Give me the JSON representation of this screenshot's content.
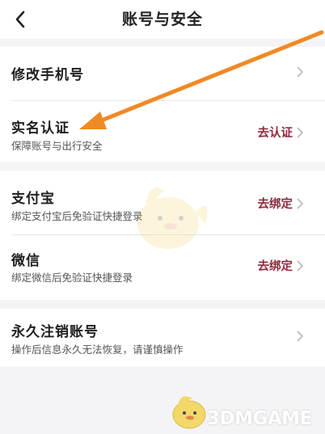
{
  "header": {
    "title": "账号与安全",
    "back_icon": "chevron-left-icon"
  },
  "rows": [
    {
      "title": "修改手机号",
      "subtitle": "",
      "action": ""
    },
    {
      "title": "实名认证",
      "subtitle": "保障账号与出行安全",
      "action": "去认证"
    },
    {
      "title": "支付宝",
      "subtitle": "绑定支付宝后免验证快捷登录",
      "action": "去绑定"
    },
    {
      "title": "微信",
      "subtitle": "绑定微信后免验证快捷登录",
      "action": "去绑定"
    },
    {
      "title": "永久注销账号",
      "subtitle": "操作后信息永久无法恢复，请谨慎操作",
      "action": ""
    }
  ],
  "watermark": {
    "text": "3DMGAME"
  },
  "colors": {
    "action": "#8e2a3c",
    "annotation_arrow": "#f08a24",
    "background": "#f4f4f6",
    "card": "#ffffff"
  }
}
